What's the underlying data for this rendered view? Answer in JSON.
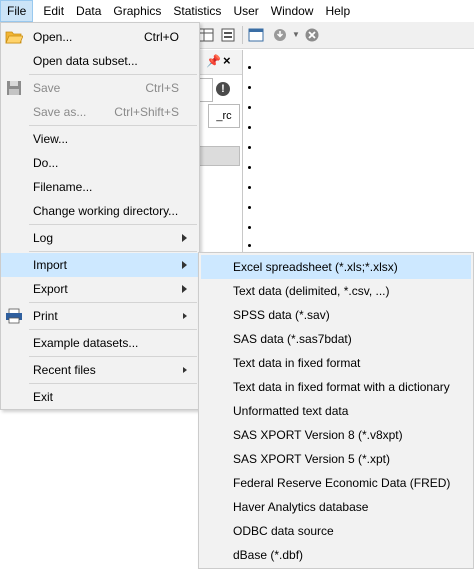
{
  "menubar": {
    "items": [
      "File",
      "Edit",
      "Data",
      "Graphics",
      "Statistics",
      "User",
      "Window",
      "Help"
    ]
  },
  "background": {
    "rc_label": "_rc",
    "error_glyph": "!"
  },
  "file_menu": {
    "open": {
      "label": "Open...",
      "shortcut": "Ctrl+O"
    },
    "open_subset": {
      "label": "Open data subset..."
    },
    "save": {
      "label": "Save",
      "shortcut": "Ctrl+S"
    },
    "save_as": {
      "label": "Save as...",
      "shortcut": "Ctrl+Shift+S"
    },
    "view": {
      "label": "View..."
    },
    "do": {
      "label": "Do..."
    },
    "filename": {
      "label": "Filename..."
    },
    "change_dir": {
      "label": "Change working directory..."
    },
    "log": {
      "label": "Log"
    },
    "import": {
      "label": "Import"
    },
    "export": {
      "label": "Export"
    },
    "print": {
      "label": "Print"
    },
    "example": {
      "label": "Example datasets..."
    },
    "recent": {
      "label": "Recent files"
    },
    "exit": {
      "label": "Exit"
    }
  },
  "import_menu": {
    "items": [
      "Excel spreadsheet (*.xls;*.xlsx)",
      "Text data (delimited, *.csv, ...)",
      "SPSS data (*.sav)",
      "SAS data (*.sas7bdat)",
      "Text data in fixed format",
      "Text data in fixed format with a dictionary",
      "Unformatted text data",
      "SAS XPORT Version 8 (*.v8xpt)",
      "SAS XPORT Version 5 (*.xpt)",
      "Federal Reserve Economic Data (FRED)",
      "Haver Analytics database",
      "ODBC data source",
      "dBase (*.dbf)"
    ]
  },
  "colors": {
    "highlight": "#cde8ff",
    "menu_bg": "#f2f2f2",
    "disabled_text": "#8a8a8a",
    "folder_icon": "#f2b534",
    "disk_icon": "#7a7a7a",
    "printer_icon": "#2f5f9e"
  }
}
